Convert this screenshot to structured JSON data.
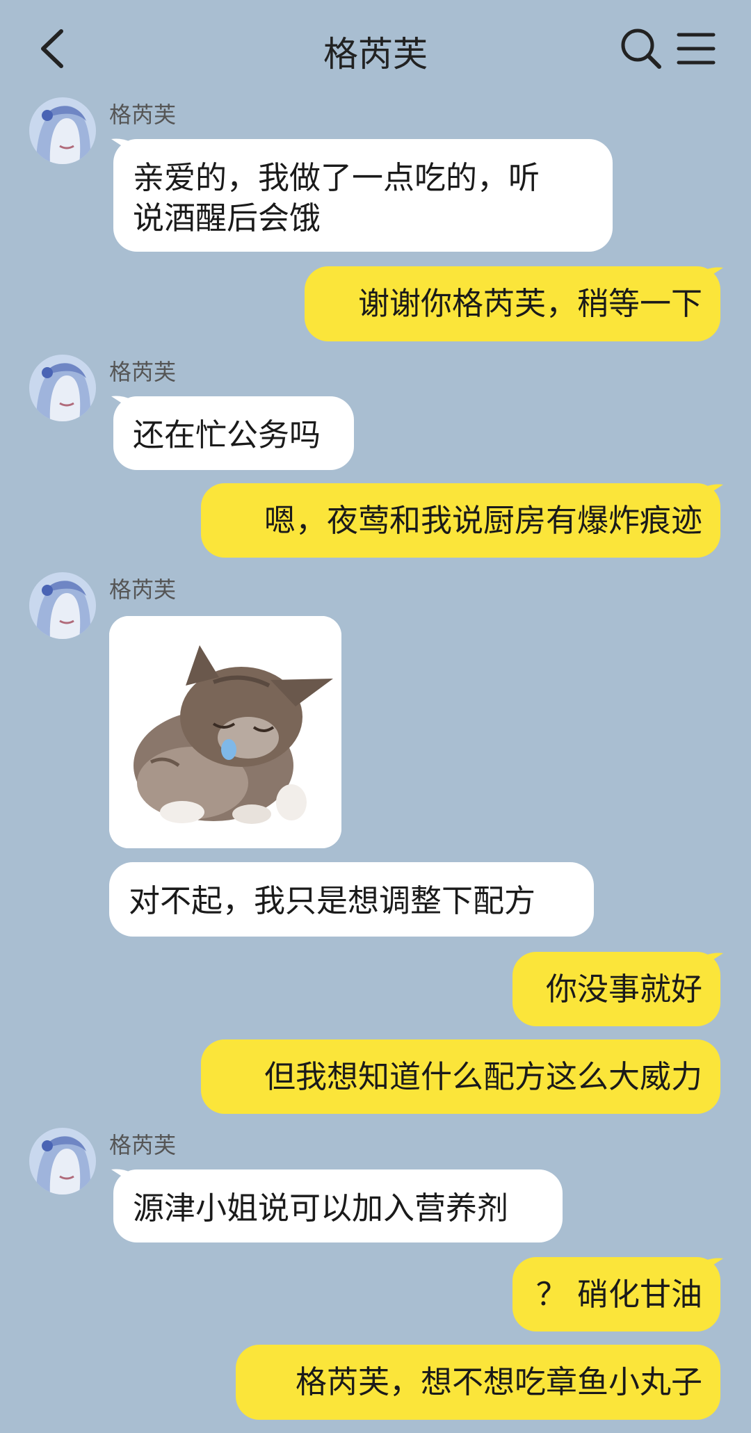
{
  "header": {
    "title": "格芮芙",
    "back_icon": "chevron-left-icon",
    "search_icon": "search-icon",
    "menu_icon": "menu-icon"
  },
  "contact": {
    "name": "格芮芙"
  },
  "messages": [
    {
      "side": "left",
      "sender": "格芮芙",
      "text": "亲爱的，我做了一点吃的，听\n说酒醒后会饿"
    },
    {
      "side": "right",
      "text": "谢谢你格芮芙，稍等一下"
    },
    {
      "side": "left",
      "sender": "格芮芙",
      "text": "还在忙公务吗"
    },
    {
      "side": "right",
      "text": "嗯，夜莺和我说厨房有爆炸痕迹"
    },
    {
      "side": "left",
      "sender": "格芮芙",
      "sticker": "crying-kitten-sticker"
    },
    {
      "side": "left",
      "text": "对不起，我只是想调整下配方"
    },
    {
      "side": "right",
      "text": "你没事就好"
    },
    {
      "side": "right",
      "text": "但我想知道什么配方这么大威力"
    },
    {
      "side": "left",
      "sender": "格芮芙",
      "text": "源津小姐说可以加入营养剂"
    },
    {
      "side": "right",
      "text": "？ 硝化甘油"
    },
    {
      "side": "right",
      "text": "格芮芙，想不想吃章鱼小丸子"
    }
  ],
  "colors": {
    "background": "#a9bed1",
    "bubble_left": "#ffffff",
    "bubble_right": "#fbe53a"
  }
}
